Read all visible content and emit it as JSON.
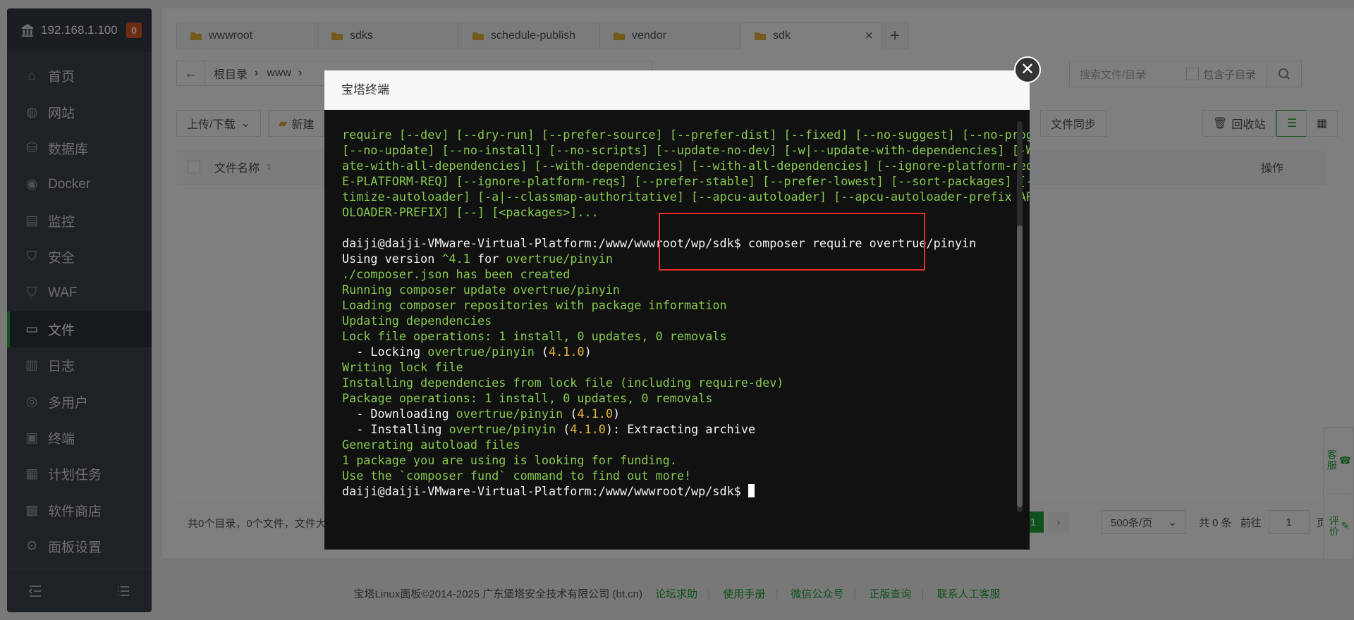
{
  "sidebar": {
    "ip": "192.168.1.100",
    "badge": "0",
    "items": [
      {
        "label": "首页",
        "icon": "home-icon"
      },
      {
        "label": "网站",
        "icon": "globe-icon"
      },
      {
        "label": "数据库",
        "icon": "database-icon"
      },
      {
        "label": "Docker",
        "icon": "docker-icon"
      },
      {
        "label": "监控",
        "icon": "monitor-icon"
      },
      {
        "label": "安全",
        "icon": "shield-icon"
      },
      {
        "label": "WAF",
        "icon": "waf-shield-icon"
      },
      {
        "label": "文件",
        "icon": "folder-icon",
        "active": true
      },
      {
        "label": "日志",
        "icon": "log-icon"
      },
      {
        "label": "多用户",
        "icon": "users-icon"
      },
      {
        "label": "终端",
        "icon": "terminal-icon"
      },
      {
        "label": "计划任务",
        "icon": "calendar-icon"
      },
      {
        "label": "软件商店",
        "icon": "apps-icon"
      },
      {
        "label": "面板设置",
        "icon": "gear-icon"
      }
    ]
  },
  "tabs": [
    {
      "label": "wwwroot"
    },
    {
      "label": "sdks"
    },
    {
      "label": "schedule-publish"
    },
    {
      "label": "vendor"
    },
    {
      "label": "sdk",
      "active": true
    }
  ],
  "breadcrumb": {
    "root": "根目录",
    "first": "www"
  },
  "search": {
    "placeholder": "搜索文件/目录",
    "include_sub": "包含子目录"
  },
  "toolbar": {
    "upload": "上传/下载",
    "new": "新建",
    "sync": "文件同步",
    "recycle": "回收站"
  },
  "table": {
    "col_name": "文件名称",
    "col_ops": "操作"
  },
  "footer": {
    "summary": "共0个目录，0个文件，文件大",
    "page": "1",
    "page_size": "500条/页",
    "total": "共 0 条",
    "goto_label": "前往",
    "goto_value": "1",
    "page_suffix": "页"
  },
  "copyright": {
    "text": "宝塔Linux面板©2014-2025 广东堡塔安全技术有限公司 (bt.cn)",
    "links": [
      "论坛求助",
      "使用手册",
      "微信公众号",
      "正版查询",
      "联系人工客服"
    ]
  },
  "side_float": {
    "service": "客服",
    "feedback": "评价"
  },
  "modal": {
    "title": "宝塔终端",
    "terminal": {
      "help_lines": [
        "require [--dev] [--dry-run] [--prefer-source] [--prefer-dist] [--fixed] [--no-suggest] [--no-progress]",
        "[--no-update] [--no-install] [--no-scripts] [--update-no-dev] [-w|--update-with-dependencies] [-W|--upd",
        "ate-with-all-dependencies] [--with-dependencies] [--with-all-dependencies] [--ignore-platform-req IGNOR",
        "E-PLATFORM-REQ] [--ignore-platform-reqs] [--prefer-stable] [--prefer-lowest] [--sort-packages] [-o|--op",
        "timize-autoloader] [-a|--classmap-authoritative] [--apcu-autoloader] [--apcu-autoloader-prefix APCU-AUT",
        "OLOADER-PREFIX] [--] [<packages>]..."
      ],
      "prompt": "daiji@daiji-VMware-Virtual-Platform:/www/wwwroot/wp/sdk$",
      "command": " composer require overtrue/pinyin",
      "using_version_pre": "Using version ",
      "using_version_ver": "^4.1",
      "using_version_for": " for ",
      "package": "overtrue/pinyin",
      "version": "4.1.0",
      "lines_a": [
        "./composer.json has been created",
        "Running composer update overtrue/pinyin",
        "Loading composer repositories with package information",
        "Updating dependencies",
        "Lock file operations: 1 install, 0 updates, 0 removals"
      ],
      "locking": "  - Locking ",
      "lines_b": [
        "Writing lock file",
        "Installing dependencies from lock file (including require-dev)",
        "Package operations: 1 install, 0 updates, 0 removals"
      ],
      "downloading": "  - Downloading ",
      "installing": "  - Installing ",
      "extracting": ": Extracting archive",
      "lines_c": [
        "Generating autoload files",
        "1 package you are using is looking for funding.",
        "Use the `composer fund` command to find out more!"
      ]
    }
  },
  "colors": {
    "accent": "#20a53a",
    "sidebar_bg": "#3c444d",
    "terminal_bg": "#111111",
    "terminal_green": "#85c84e",
    "terminal_yellow": "#e3b53c",
    "highlight": "#e52b2b"
  }
}
